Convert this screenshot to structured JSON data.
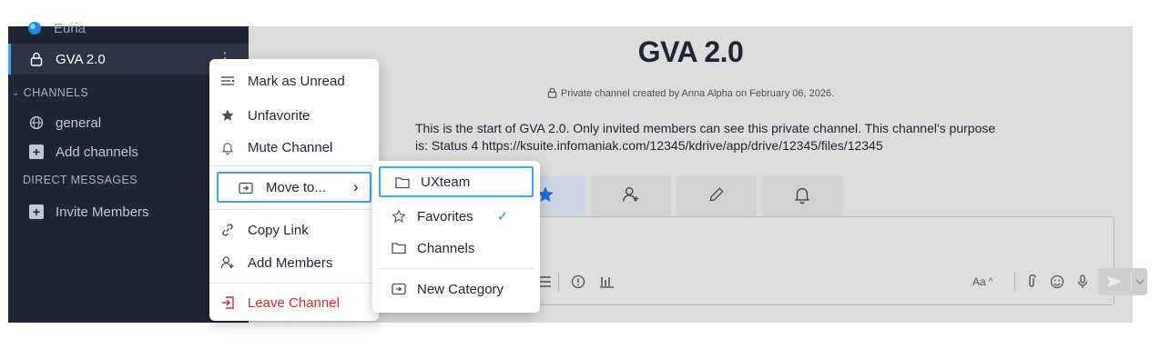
{
  "sidebar": {
    "top_item": "Euria",
    "active_channel": "GVA 2.0",
    "channels_header": "CHANNELS",
    "channels": [
      {
        "label": "general",
        "icon": "globe-icon"
      },
      {
        "label": "Add channels",
        "icon": "plus-box-icon"
      }
    ],
    "dm_header": "DIRECT MESSAGES",
    "invite": "Invite Members",
    "more_glyph": "⋮"
  },
  "main": {
    "title": "GVA 2.0",
    "subtitle": "Private channel created by Anna Alpha on February 06, 2026.",
    "intro": "This is the start of GVA 2.0. Only invited members can see this private channel. This channel's purpose is: Status 4 https://ksuite.infomaniak.com/12345/kdrive/app/drive/12345/files/12345",
    "actions": [
      {
        "icon": "star-icon"
      },
      {
        "icon": "add-member-icon"
      },
      {
        "icon": "pencil-icon"
      },
      {
        "icon": "bell-icon"
      }
    ],
    "composer": {
      "aa_label": "Aa",
      "aa_chevron": "^"
    }
  },
  "context_menu": {
    "items": [
      {
        "label": "Mark as Unread",
        "icon": "mark-unread-icon"
      },
      {
        "label": "Unfavorite",
        "icon": "star-icon"
      },
      {
        "label": "Mute Channel",
        "icon": "bell-icon"
      },
      {
        "label": "Move to...",
        "icon": "move-icon",
        "submenu_arrow": "›"
      },
      {
        "label": "Copy Link",
        "icon": "link-icon"
      },
      {
        "label": "Add Members",
        "icon": "add-member-icon"
      },
      {
        "label": "Leave Channel",
        "icon": "leave-icon"
      }
    ]
  },
  "submenu": {
    "items": [
      {
        "label": "UXteam",
        "icon": "folder-icon"
      },
      {
        "label": "Favorites",
        "icon": "star-outline-icon",
        "checked": true,
        "check": "✓"
      },
      {
        "label": "Channels",
        "icon": "folder-icon"
      },
      {
        "label": "New Category",
        "icon": "new-category-icon"
      }
    ]
  },
  "colors": {
    "sidebar_bg": "#1f2532",
    "accent": "#3ea6ff",
    "danger": "#e0262d",
    "main_overlay": "#dcdcdc"
  }
}
